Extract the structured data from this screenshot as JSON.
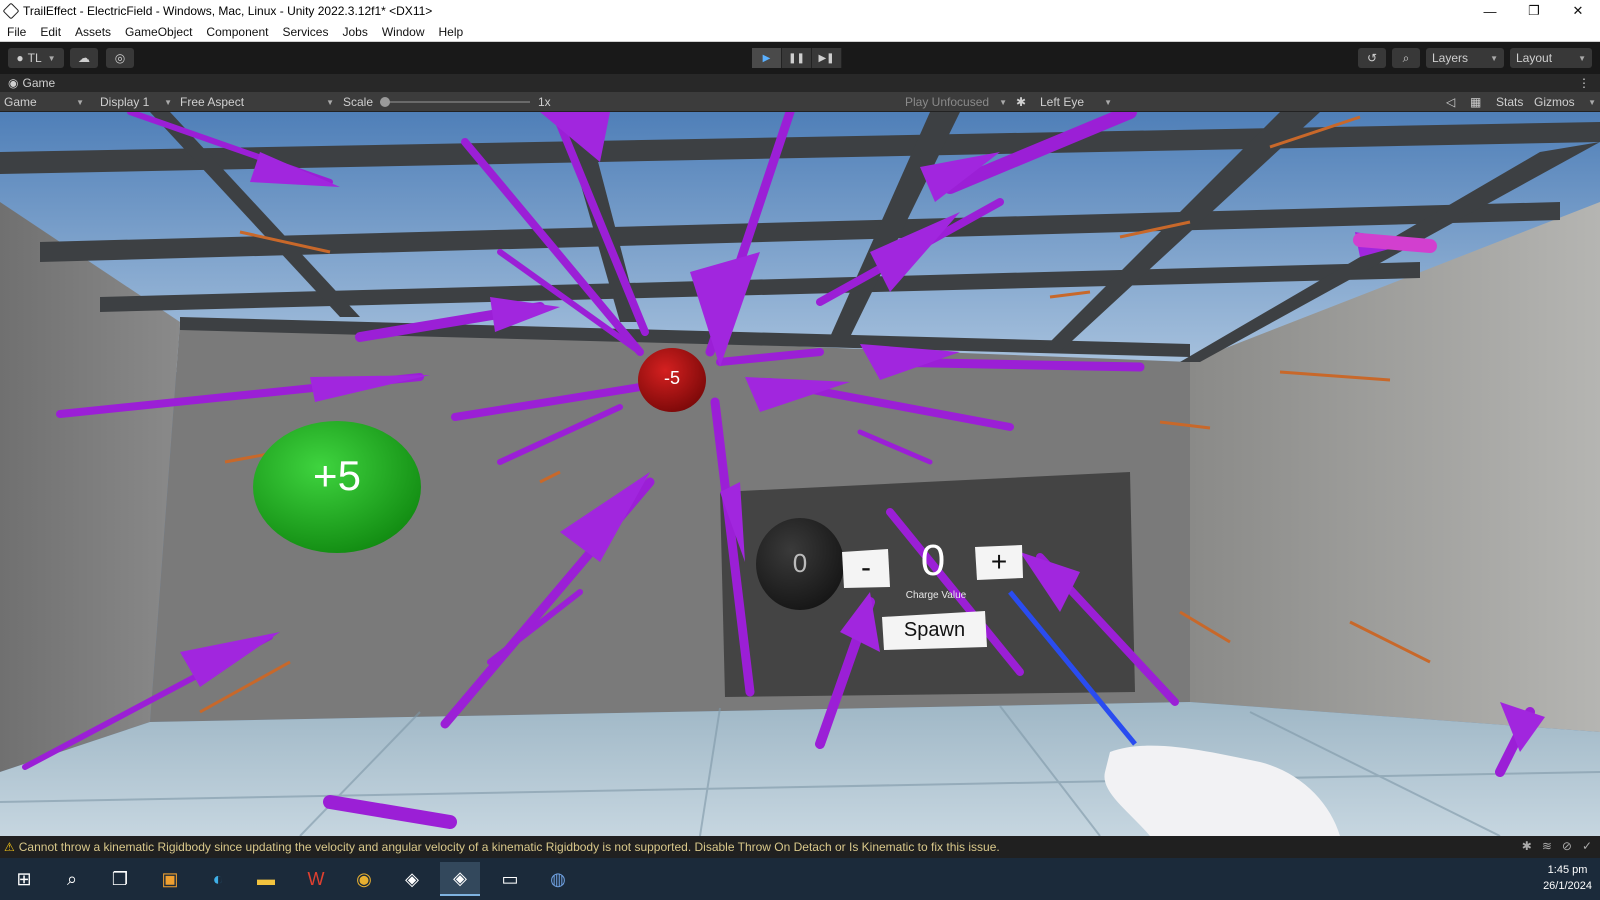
{
  "window": {
    "title": "TrailEffect - ElectricField - Windows, Mac, Linux - Unity 2022.3.12f1* <DX11>",
    "minimize": "—",
    "maximize": "❐",
    "close": "✕"
  },
  "menu": [
    "File",
    "Edit",
    "Assets",
    "GameObject",
    "Component",
    "Services",
    "Jobs",
    "Window",
    "Help"
  ],
  "toolbar": {
    "account": "TL",
    "layers": "Layers",
    "layout": "Layout"
  },
  "game_tab": {
    "label": "Game"
  },
  "game_bar": {
    "view": "Game",
    "display": "Display 1",
    "aspect": "Free Aspect",
    "scale_label": "Scale",
    "scale_value": "1x",
    "play_focus": "Play Unfocused",
    "eye": "Left Eye",
    "stats": "Stats",
    "gizmos": "Gizmos"
  },
  "scene": {
    "positive_charge": "+5",
    "negative_charge": "-5",
    "preview_charge": "0",
    "minus_button": "-",
    "charge_value": "0",
    "plus_button": "+",
    "charge_value_label": "Charge Value",
    "spawn_button": "Spawn"
  },
  "status": {
    "message": "Cannot throw a kinematic Rigidbody since updating the velocity and angular velocity of a kinematic Rigidbody is not supported. Disable Throw On Detach or Is Kinematic to fix this issue."
  },
  "taskbar": {
    "time": "1:45 pm",
    "date": "26/1/2024"
  },
  "colors": {
    "arrow_purple": "#9b1fd6",
    "arrow_orange": "#c8682a",
    "positive": "#1ea81e",
    "negative": "#b01010"
  }
}
